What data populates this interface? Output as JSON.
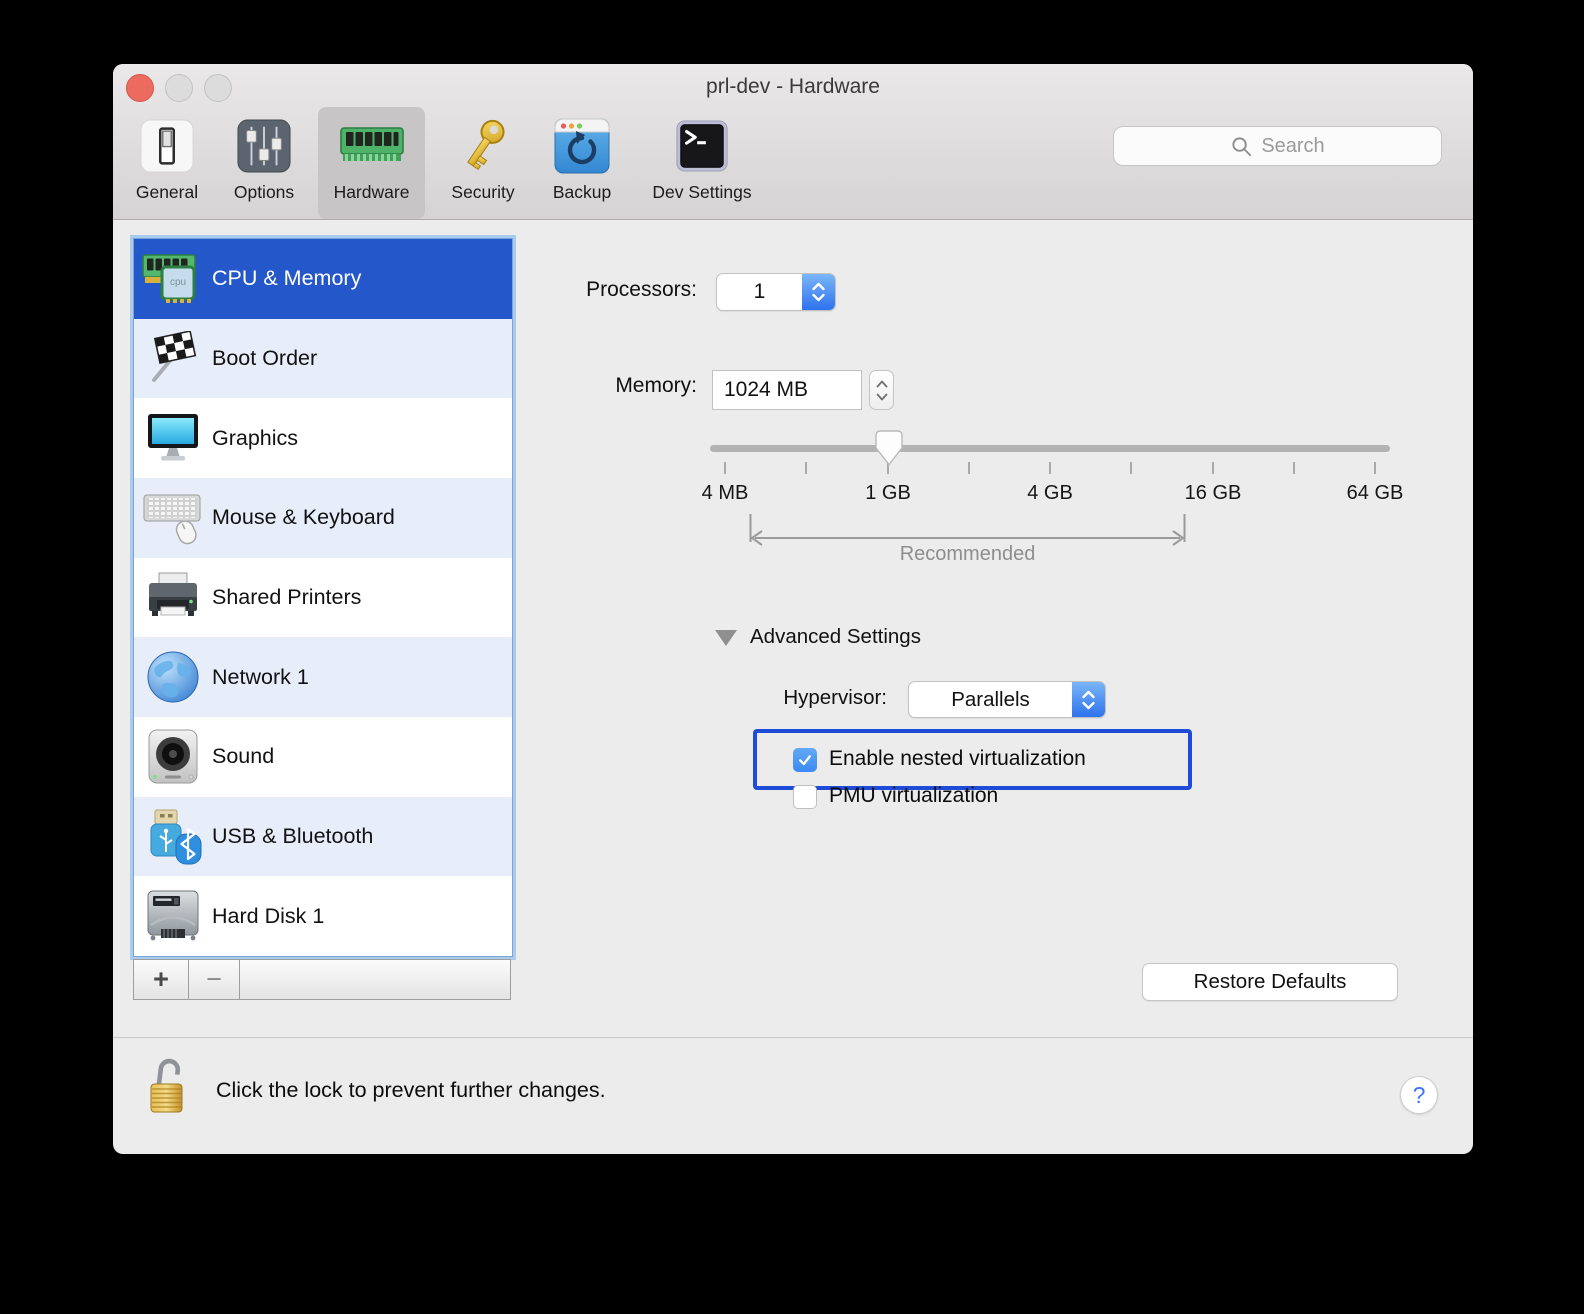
{
  "window": {
    "title": "prl-dev - Hardware"
  },
  "toolbar": {
    "search_placeholder": "Search",
    "items": [
      {
        "label": "General",
        "icon": "general-switch-icon",
        "selected": false
      },
      {
        "label": "Options",
        "icon": "options-sliders-icon",
        "selected": false
      },
      {
        "label": "Hardware",
        "icon": "ram-module-icon",
        "selected": true
      },
      {
        "label": "Security",
        "icon": "key-icon",
        "selected": false
      },
      {
        "label": "Backup",
        "icon": "backup-window-icon",
        "selected": false
      },
      {
        "label": "Dev Settings",
        "icon": "terminal-icon",
        "selected": false
      }
    ]
  },
  "sidebar": {
    "items": [
      {
        "label": "CPU & Memory",
        "icon": "cpu-memory-icon",
        "selected": true,
        "chip_label": "cpu"
      },
      {
        "label": "Boot Order",
        "icon": "boot-flag-icon",
        "selected": false
      },
      {
        "label": "Graphics",
        "icon": "graphics-monitor-icon",
        "selected": false
      },
      {
        "label": "Mouse & Keyboard",
        "icon": "mouse-keyboard-icon",
        "selected": false
      },
      {
        "label": "Shared Printers",
        "icon": "printer-icon",
        "selected": false
      },
      {
        "label": "Network 1",
        "icon": "network-globe-icon",
        "selected": false
      },
      {
        "label": "Sound",
        "icon": "speaker-icon",
        "selected": false
      },
      {
        "label": "USB & Bluetooth",
        "icon": "usb-bluetooth-icon",
        "selected": false
      },
      {
        "label": "Hard Disk 1",
        "icon": "hard-disk-icon",
        "selected": false
      }
    ],
    "add_label": "+",
    "remove_label": "−"
  },
  "main": {
    "processors": {
      "label": "Processors:",
      "value": "1"
    },
    "memory": {
      "label": "Memory:",
      "value": "1024 MB"
    },
    "slider": {
      "value": "1 GB",
      "tick_labels": [
        "4 MB",
        "1 GB",
        "4 GB",
        "16 GB",
        "64 GB"
      ],
      "recommended_label": "Recommended"
    },
    "advanced": {
      "label": "Advanced Settings",
      "expanded": true,
      "hypervisor_label": "Hypervisor:",
      "hypervisor_value": "Parallels",
      "checkboxes": [
        {
          "label": "Enable nested virtualization",
          "checked": true,
          "highlighted": true
        },
        {
          "label": "PMU virtualization",
          "checked": false,
          "highlighted": false
        }
      ]
    },
    "restore_defaults_label": "Restore Defaults"
  },
  "footer": {
    "lock_text": "Click the lock to prevent further changes.",
    "help_label": "?"
  },
  "colors": {
    "sidebar_selection_blue": "#2457c9",
    "control_accent_blue": "#2e72ee",
    "checkbox_blue": "#3b8af2",
    "highlight_border_blue": "#1e4bd8",
    "window_background": "#ececec",
    "help_question_blue": "#3b76f6"
  }
}
